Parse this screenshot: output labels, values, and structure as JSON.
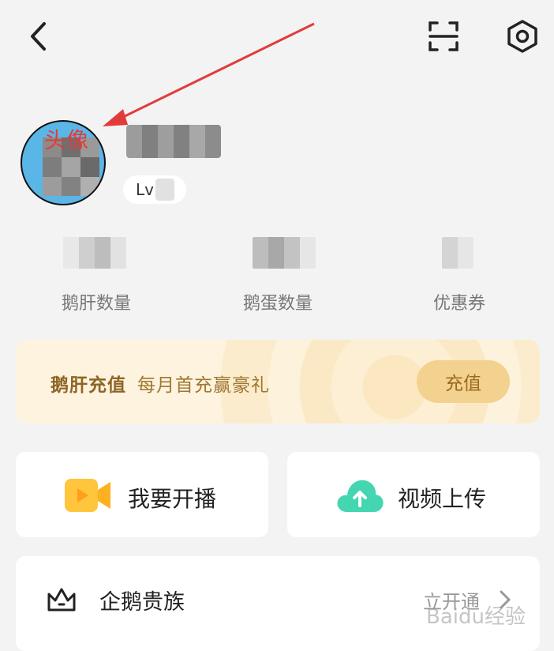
{
  "header": {
    "back_icon": "chevron-left-icon",
    "scan_icon": "scan-icon",
    "settings_icon": "hexagon-settings-icon"
  },
  "profile": {
    "avatar_overlay_text": "头像",
    "level_prefix": "Lv"
  },
  "stats": [
    {
      "label": "鹅肝数量"
    },
    {
      "label": "鹅蛋数量"
    },
    {
      "label": "优惠券"
    }
  ],
  "recharge": {
    "title": "鹅肝充值",
    "subtitle": "每月首充赢豪礼",
    "button": "充值"
  },
  "actions": [
    {
      "label": "我要开播",
      "icon": "video-camera-icon",
      "color": "#ffc53d"
    },
    {
      "label": "视频上传",
      "icon": "cloud-upload-icon",
      "color": "#43d6b0"
    }
  ],
  "vip": {
    "label": "企鹅贵族",
    "icon": "crown-icon",
    "right_text": "立开通"
  },
  "watermark": "Baidu经验",
  "colors": {
    "background": "#f3f3f3",
    "accent_gold": "#a0762f",
    "annotation_red": "#e33b3b"
  }
}
